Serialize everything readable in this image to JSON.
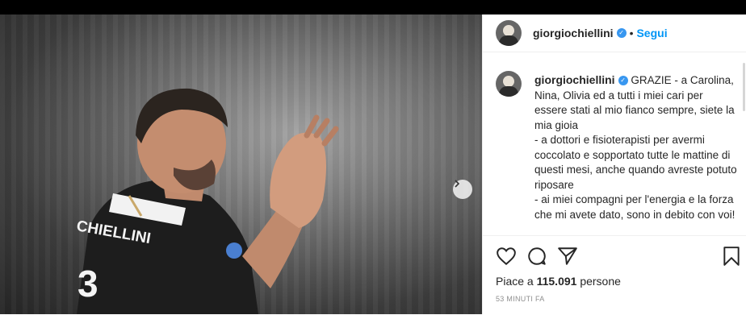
{
  "post": {
    "author": "giorgiochiellini",
    "follow_label": "Segui",
    "separator": "•",
    "caption": "GRAZIE - a Carolina, Nina, Olivia ed a tutti i miei cari per essere stati al mio fianco sempre, siete la mia gioia\n- a dottori e fisioterapisti per avermi coccolato e sopportato tutte le mattine di questi mesi, anche quando avreste potuto riposare\n- ai miei compagni per l'energia e la forza che mi avete dato, sono in debito con voi!",
    "likes_prefix": "Piace a ",
    "likes_count": "115.091",
    "likes_suffix": " persone",
    "timestamp": "53 minuti fa",
    "jersey_name": "CHIELLINI",
    "jersey_number": "3"
  },
  "icons": {
    "like": "heart-icon",
    "comment": "comment-icon",
    "share": "share-icon",
    "save": "bookmark-icon",
    "next": "chevron-right-icon",
    "verified": "verified-badge-icon"
  },
  "colors": {
    "accent": "#0095f6",
    "verified": "#3897f0",
    "text": "#262626",
    "muted": "#8e8e8e"
  }
}
